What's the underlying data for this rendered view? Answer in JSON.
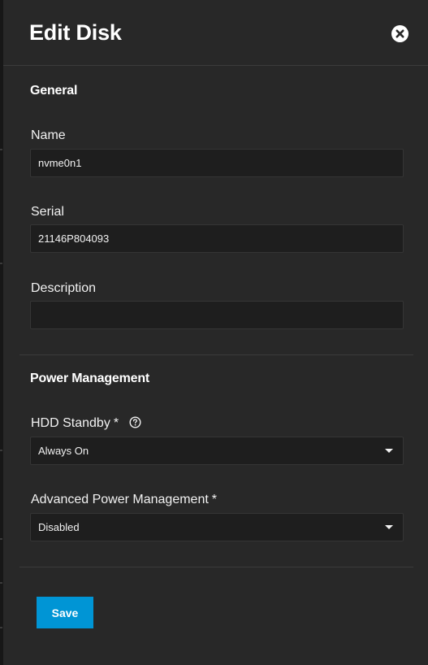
{
  "dialog": {
    "title": "Edit Disk",
    "close_icon": "close-circle-icon"
  },
  "general": {
    "section_title": "General",
    "name": {
      "label": "Name",
      "value": "nvme0n1"
    },
    "serial": {
      "label": "Serial",
      "value": "21146P804093"
    },
    "description": {
      "label": "Description",
      "value": ""
    }
  },
  "power_management": {
    "section_title": "Power Management",
    "hdd_standby": {
      "label": "HDD Standby",
      "required_mark": "*",
      "help_icon": "help-circle-icon",
      "selected": "Always On"
    },
    "advanced_power_management": {
      "label": "Advanced Power Management",
      "required_mark": "*",
      "selected": "Disabled"
    }
  },
  "actions": {
    "save_label": "Save"
  },
  "colors": {
    "panel_bg": "#282828",
    "input_bg": "#1e1e1e",
    "primary_button": "#0095d5"
  }
}
